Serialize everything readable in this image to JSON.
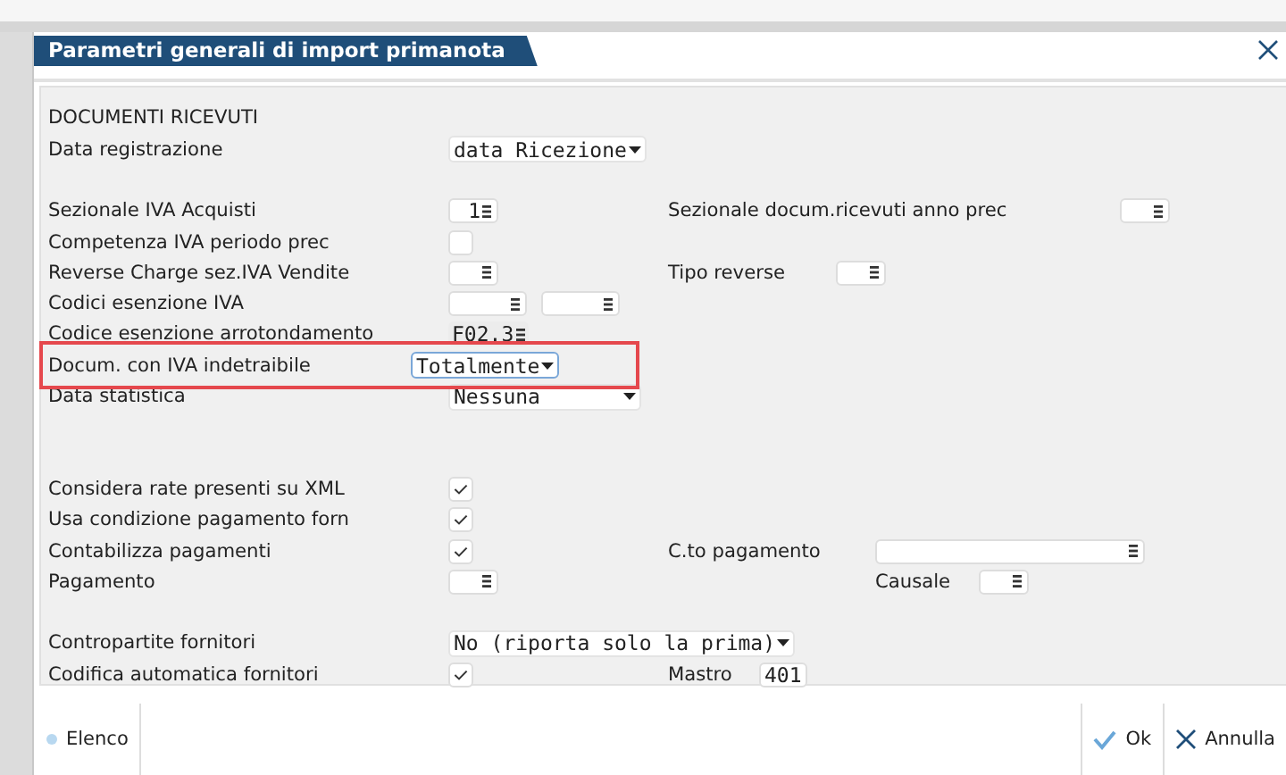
{
  "window": {
    "title": "Parametri generali di import primanota"
  },
  "section_title": "DOCUMENTI RICEVUTI",
  "groups": [
    [
      {
        "label": "Data registrazione",
        "controls": [
          {
            "kind": "select",
            "value": "data Ricezione"
          }
        ]
      }
    ],
    [
      {
        "label": "Sezionale IVA Acquisti",
        "controls": [
          {
            "kind": "lookup",
            "value": "1"
          }
        ],
        "side": [
          {
            "label": "Sezionale docum.ricevuti anno prec",
            "control": {
              "kind": "lookup"
            }
          }
        ]
      },
      {
        "label": "Competenza IVA periodo prec",
        "controls": [
          {
            "kind": "checkbox",
            "checked": false
          }
        ]
      },
      {
        "label": "Reverse Charge sez.IVA Vendite",
        "controls": [
          {
            "kind": "lookup"
          }
        ],
        "side": [
          {
            "label": "Tipo reverse",
            "control": {
              "kind": "lookup"
            }
          }
        ]
      },
      {
        "label": "Codici esenzione IVA",
        "controls": [
          {
            "kind": "code"
          },
          {
            "kind": "code"
          }
        ]
      },
      {
        "label": "Codice esenzione arrotondamento",
        "controls": [
          {
            "kind": "code",
            "value": "F02.3",
            "disabled": true
          }
        ]
      },
      {
        "label": "Docum. con IVA indetraibile",
        "highlighted": true,
        "controls": [
          {
            "kind": "select",
            "value": "Totalmente",
            "focused": true
          }
        ]
      },
      {
        "label": "Data statistica",
        "controls": [
          {
            "kind": "select",
            "value": "Nessuna"
          }
        ]
      }
    ],
    [
      {
        "label": "Considera rate presenti su XML",
        "controls": [
          {
            "kind": "checkbox",
            "checked": true
          }
        ]
      },
      {
        "label": "Usa condizione pagamento forn",
        "controls": [
          {
            "kind": "checkbox",
            "checked": true
          }
        ]
      },
      {
        "label": "Contabilizza pagamenti",
        "controls": [
          {
            "kind": "checkbox",
            "checked": true
          }
        ],
        "side": [
          {
            "label": "C.to pagamento",
            "control": {
              "kind": "account"
            }
          }
        ]
      },
      {
        "label": "Pagamento",
        "controls": [
          {
            "kind": "lookup"
          }
        ],
        "side": [
          {
            "label": "Causale",
            "control": {
              "kind": "lookup"
            }
          }
        ]
      }
    ],
    [
      {
        "label": "Contropartite fornitori",
        "controls": [
          {
            "kind": "select",
            "value": "No (riporta solo la prima)"
          }
        ]
      },
      {
        "label": "Codifica automatica fornitori",
        "controls": [
          {
            "kind": "checkbox",
            "checked": true
          }
        ],
        "side": [
          {
            "label": "Mastro",
            "control": {
              "kind": "number",
              "value": "401"
            }
          }
        ]
      }
    ]
  ],
  "footer": {
    "left": [
      {
        "label": "Elenco"
      }
    ],
    "buttons": [
      {
        "kind": "ok",
        "label": "Ok"
      },
      {
        "kind": "cancel",
        "label": "Annulla"
      }
    ]
  }
}
